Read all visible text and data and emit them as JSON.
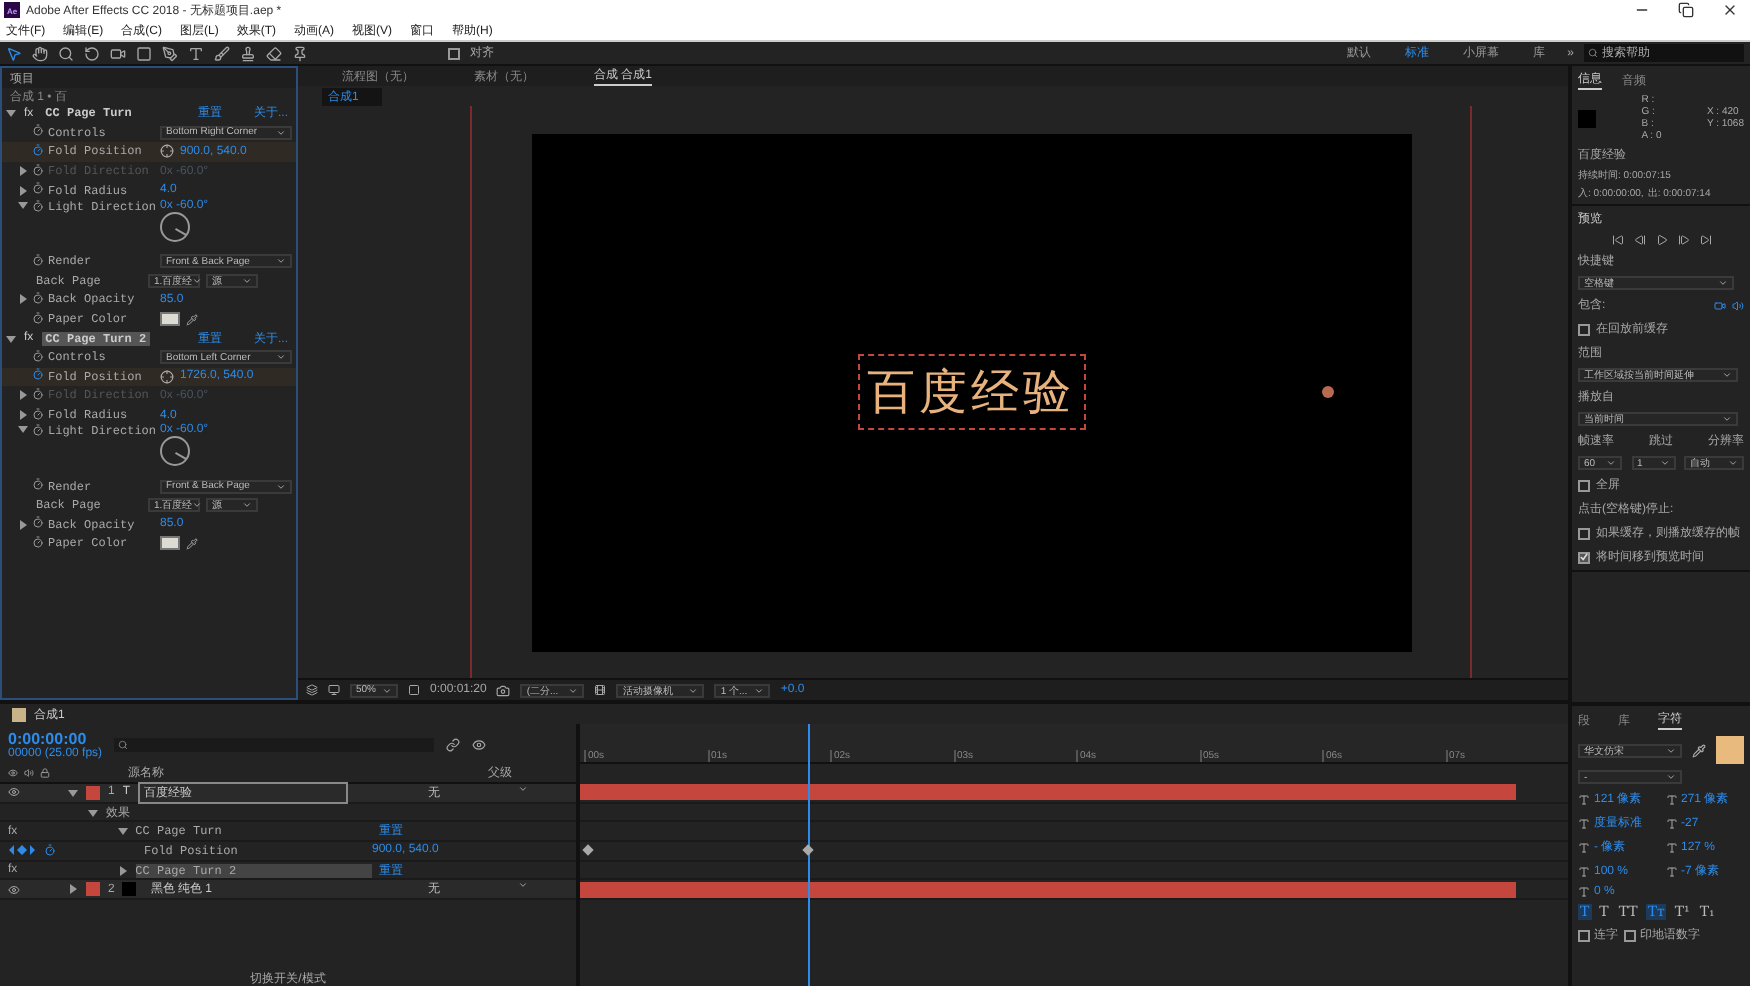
{
  "window": {
    "app_icon_label": "Ae",
    "title": "Adobe After Effects CC 2018 - 无标题项目.aep *"
  },
  "menu": [
    "文件(F)",
    "编辑(E)",
    "合成(C)",
    "图层(L)",
    "效果(T)",
    "动画(A)",
    "视图(V)",
    "窗口",
    "帮助(H)"
  ],
  "toolbar": {
    "snap_label": "对齐",
    "snap_checked": false,
    "workspaces": [
      {
        "label": "默认",
        "selected": false
      },
      {
        "label": "标准",
        "selected": true
      },
      {
        "label": "小屏幕",
        "selected": false
      },
      {
        "label": "库",
        "selected": false
      }
    ],
    "more": "»",
    "search": {
      "placeholder": "搜索帮助"
    }
  },
  "effect_panel": {
    "tab": "项目",
    "breadcrumb": "合成 1 • 百",
    "effects": [
      {
        "fx_label": "fx",
        "name": "CC Page Turn",
        "selected": false,
        "reset": "重置",
        "about": "关于...",
        "props": [
          {
            "kind": "dropdown",
            "name": "Controls",
            "value": "Bottom Right Corner",
            "keyframed": false
          },
          {
            "kind": "point",
            "name": "Fold Position",
            "value": "900.0, 540.0",
            "keyframed": true
          },
          {
            "kind": "value",
            "name": "Fold Direction",
            "value": "0x -60.0°",
            "keyframed": false,
            "disabled": true,
            "expanded": false
          },
          {
            "kind": "value",
            "name": "Fold Radius",
            "value": "4.0",
            "keyframed": false,
            "disabled": false,
            "expanded": false
          },
          {
            "kind": "angle",
            "name": "Light Direction",
            "value": "0x -60.0°",
            "keyframed": false,
            "expanded": true
          },
          {
            "kind": "dropdown",
            "name": "Render",
            "value": "Front & Back Page",
            "keyframed": false
          },
          {
            "kind": "pair",
            "name": "Back Page",
            "value": "1.百度经",
            "value_2": "源"
          },
          {
            "kind": "value",
            "name": "Back Opacity",
            "value": "85.0",
            "keyframed": false,
            "disabled": false,
            "expanded": false
          },
          {
            "kind": "color",
            "name": "Paper Color",
            "color": "#dcdcd2",
            "keyframed": false
          }
        ]
      },
      {
        "fx_label": "fx",
        "name": "CC Page Turn 2",
        "selected": true,
        "reset": "重置",
        "about": "关于...",
        "props": [
          {
            "kind": "dropdown",
            "name": "Controls",
            "value": "Bottom Left Corner",
            "keyframed": false
          },
          {
            "kind": "point",
            "name": "Fold Position",
            "value": "1726.0, 540.0",
            "keyframed": true
          },
          {
            "kind": "value",
            "name": "Fold Direction",
            "value": "0x -60.0°",
            "keyframed": false,
            "disabled": true,
            "expanded": false
          },
          {
            "kind": "value",
            "name": "Fold Radius",
            "value": "4.0",
            "keyframed": false,
            "disabled": false,
            "expanded": false
          },
          {
            "kind": "angle",
            "name": "Light Direction",
            "value": "0x -60.0°",
            "keyframed": false,
            "expanded": true
          },
          {
            "kind": "dropdown",
            "name": "Render",
            "value": "Front & Back Page",
            "keyframed": false
          },
          {
            "kind": "pair",
            "name": "Back Page",
            "value": "1.百度经",
            "value_2": "源"
          },
          {
            "kind": "value",
            "name": "Back Opacity",
            "value": "85.0",
            "keyframed": false,
            "disabled": false,
            "expanded": false
          },
          {
            "kind": "color",
            "name": "Paper Color",
            "color": "#dcdcd2",
            "keyframed": false
          }
        ]
      }
    ]
  },
  "viewer": {
    "tabs": [
      {
        "label": "流程图（无）",
        "selected": false
      },
      {
        "label": "素材（无）",
        "selected": false
      },
      {
        "label": "合成 合成1",
        "selected": true
      }
    ],
    "subtab": "合成1",
    "text": "百度经验",
    "bar": {
      "zoom": "50%",
      "time": "0:00:01:20",
      "resolution": "(二分...",
      "camera": "活动摄像机",
      "views": "1 个...",
      "exposure": "+0.0"
    }
  },
  "info": {
    "tabs": [
      {
        "label": "信息",
        "selected": true
      },
      {
        "label": "音频",
        "selected": false
      }
    ],
    "channels": [
      "R :",
      "G :",
      "B :",
      "A : 0"
    ],
    "x": "X : 420",
    "y": "Y : 1068",
    "layer": "百度经验",
    "duration": "持续时间: 0:00:07:15",
    "in": "入: 0:00:00:00,",
    "out": "出: 0:00:07:14"
  },
  "preview": {
    "tab": "预览",
    "shortcut_label": "快捷键",
    "shortcut": "空格键",
    "include_label": "包含:",
    "cache": {
      "label": "在回放前缓存",
      "checked": false
    },
    "range_label": "范围",
    "range": "工作区域按当前时间延伸",
    "play_from_label": "播放自",
    "play_from": "当前时间",
    "labels": [
      "帧速率",
      "跳过",
      "分辨率"
    ],
    "values": [
      "60",
      "1",
      "自动"
    ],
    "fullscreen": {
      "label": "全屏",
      "checked": false
    },
    "stop_label": "点击(空格键)停止:",
    "options": [
      {
        "label": "如果缓存，则播放缓存的帧",
        "checked": false
      },
      {
        "label": "将时间移到预览时间",
        "checked": true
      }
    ]
  },
  "timeline": {
    "tab": "合成1",
    "timecode": "0:00:00:00",
    "fps": "00000 (25.00 fps)",
    "columns": [
      "源名称",
      "父级"
    ],
    "ticks": [
      "00s",
      "01s",
      "02s",
      "03s",
      "04s",
      "05s",
      "06s",
      "07s"
    ],
    "layers": [
      {
        "kind": "text",
        "number": "1",
        "glyph": "T",
        "name": "百度经验",
        "parent": "无",
        "color": "#c4463d",
        "expanded": true,
        "group": "效果",
        "effects": [
          {
            "fx_label": "fx",
            "name": "CC Page Turn",
            "reset": "重置",
            "selected": false,
            "expanded": true,
            "props": [
              {
                "name": "Fold Position",
                "value": "900.0, 540.0"
              }
            ]
          },
          {
            "fx_label": "fx",
            "name": "CC Page Turn 2",
            "reset": "重置",
            "selected": true,
            "expanded": false
          }
        ]
      },
      {
        "kind": "solid",
        "number": "2",
        "name": "黑色 纯色 1",
        "parent": "无",
        "color": "#c4463d",
        "expanded": false
      }
    ],
    "footer": "切换开关/模式"
  },
  "character": {
    "tabs": [
      {
        "label": "段",
        "selected": false
      },
      {
        "label": "库",
        "selected": false
      },
      {
        "label": "字符",
        "selected": true
      }
    ],
    "font": "华文仿宋",
    "style": "-",
    "metrics": [
      "121 像素",
      "271 像素",
      "度量标准",
      "-27",
      "- 像素",
      "127 %",
      "100 %",
      "-7 像素",
      "0 %"
    ],
    "styles": [
      {
        "label": "T",
        "selected": true
      },
      {
        "label": "T",
        "selected": false
      },
      {
        "label": "TT",
        "selected": false
      },
      {
        "label": "Tт",
        "selected": true
      },
      {
        "label": "T¹",
        "selected": false
      },
      {
        "label": "T₁",
        "selected": false
      }
    ],
    "checks": [
      {
        "label": "连字",
        "checked": false
      },
      {
        "label": "印地语数字",
        "checked": false
      }
    ]
  }
}
